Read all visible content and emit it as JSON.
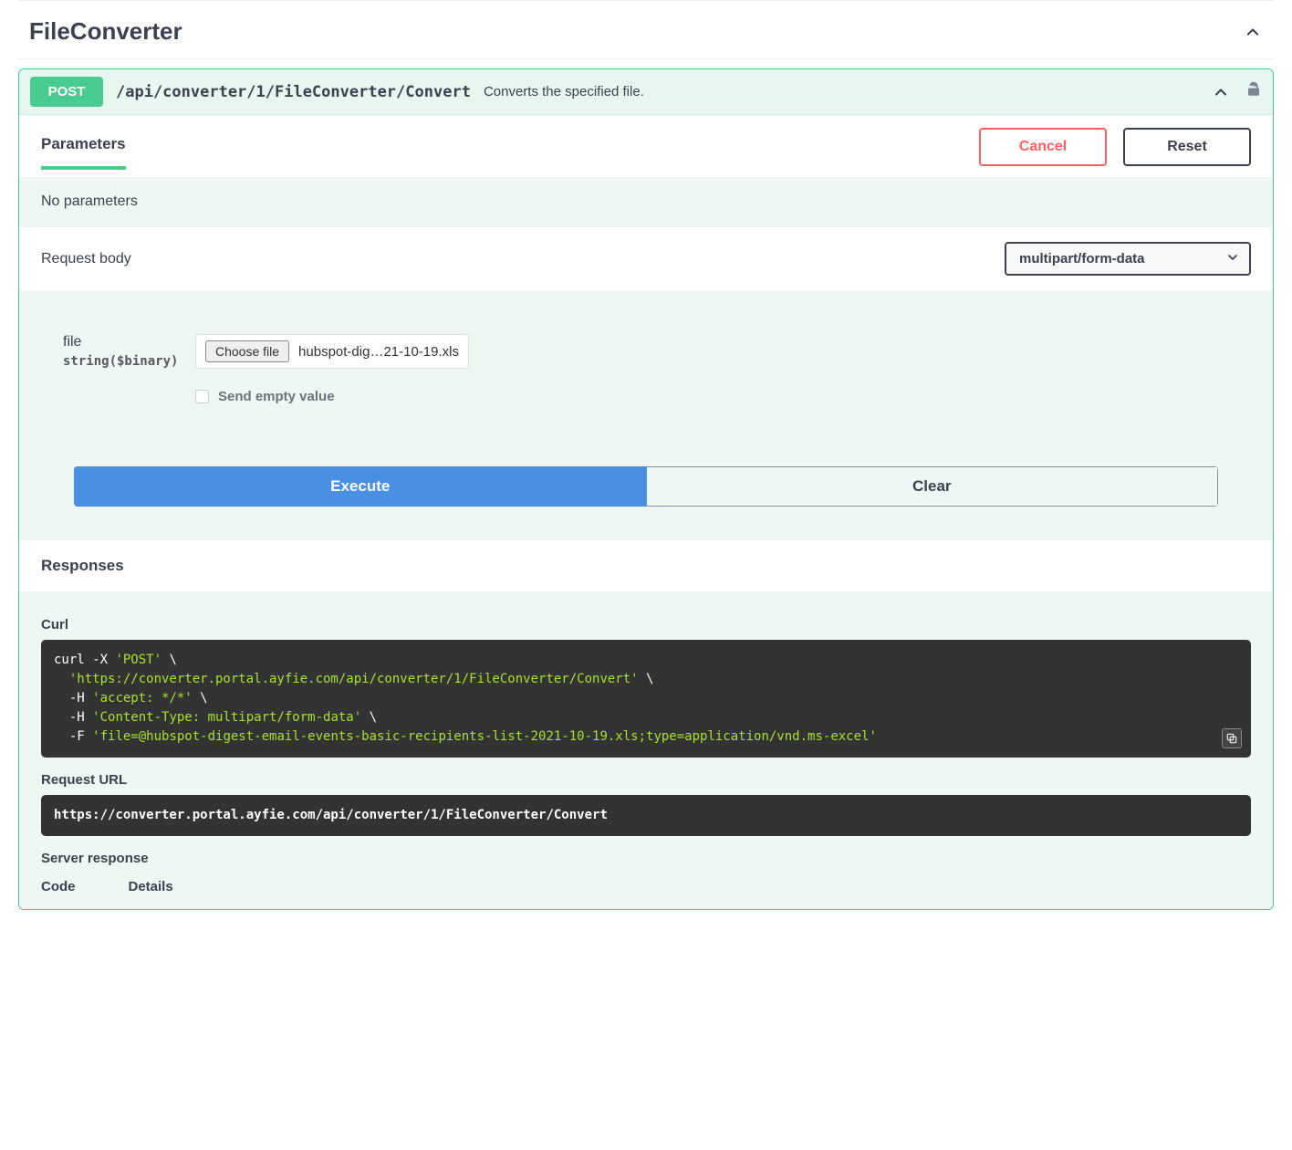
{
  "section": {
    "title": "FileConverter"
  },
  "op": {
    "method": "POST",
    "path": "/api/converter/1/FileConverter/Convert",
    "description": "Converts the specified file."
  },
  "tabs": {
    "parameters_label": "Parameters",
    "cancel_label": "Cancel",
    "reset_label": "Reset"
  },
  "no_params_text": "No parameters",
  "request_body": {
    "label": "Request body",
    "content_type": "multipart/form-data",
    "param": {
      "name": "file",
      "type": "string($binary)",
      "choose_label": "Choose file",
      "selected_file": "hubspot-dig…21-10-19.xls",
      "send_empty_label": "Send empty value"
    }
  },
  "actions": {
    "execute_label": "Execute",
    "clear_label": "Clear"
  },
  "responses": {
    "header": "Responses",
    "curl_label": "Curl",
    "curl_cmd_prefix": "curl -X ",
    "curl_method": "'POST'",
    "curl_lines": [
      "  'https://converter.portal.ayfie.com/api/converter/1/FileConverter/Convert'",
      "  -H 'accept: */*'",
      "  -H 'Content-Type: multipart/form-data'",
      "  -F 'file=@hubspot-digest-email-events-basic-recipients-list-2021-10-19.xls;type=application/vnd.ms-excel'"
    ],
    "request_url_label": "Request URL",
    "request_url": "https://converter.portal.ayfie.com/api/converter/1/FileConverter/Convert",
    "server_response_label": "Server response",
    "code_col": "Code",
    "details_col": "Details"
  }
}
